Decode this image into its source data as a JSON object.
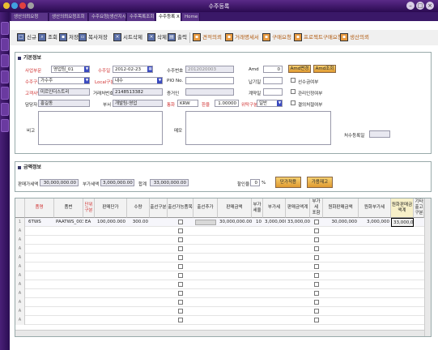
{
  "window": {
    "title": "수주등록"
  },
  "tabs": [
    {
      "label": "생산의뢰요청"
    },
    {
      "label": "생산의뢰요청조회"
    },
    {
      "label": "수주요청[생산지시]"
    },
    {
      "label": "수주목록조회"
    },
    {
      "label": "수주등록 X"
    },
    {
      "label": "Home"
    }
  ],
  "toolbar": {
    "new": "신규",
    "search": "조회",
    "save": "저장",
    "copy": "복사저장",
    "delete_sheet": "시트삭제",
    "delete": "삭제",
    "print": "출력",
    "quote": "견적의뢰",
    "trade": "거래명세서",
    "purchase": "구매요청",
    "project": "프로젝트구매요청",
    "production": "생산의뢰"
  },
  "basic": {
    "header": "기본정보",
    "labels": {
      "dept": "사업부문",
      "order_date": "수주일",
      "order_no": "수주번호",
      "amd": "Amd",
      "order_type": "수주구분",
      "local": "Local구분",
      "pio": "PIO No.",
      "due": "납기일",
      "pre_order": "선수금여부",
      "customer": "고객사명",
      "biz_no": "거래처번호",
      "cert": "증거인",
      "contract": "계약일",
      "mgmt": "관리인정여부",
      "manager": "담당자",
      "mcode": "부서",
      "currency": "통화",
      "rate": "환율",
      "tax": "위탁구분",
      "tax_check": "결의처절여부",
      "remark": "비고",
      "memo": "메모",
      "registrar": "처수등록일"
    },
    "values": {
      "dept": "영업팀_01",
      "order_date": "2012-02-23",
      "order_no": "2012020003",
      "amd": "0",
      "order_type": "가수주",
      "local": "내수",
      "customer": "미르인더스트리",
      "biz_no": "2148513382",
      "manager": "홍길동",
      "mcode": "개발팀-영업",
      "currency": "KRW",
      "rate": "1.00000",
      "tax": "일반"
    },
    "buttons": {
      "amd_change": "Amd변경",
      "amd_view": "Amd조회"
    }
  },
  "amount": {
    "header": "금액정보",
    "labels": {
      "supply": "판매가세액",
      "vat": "부가세액",
      "total": "합계",
      "discount": "할인율",
      "pct": "%"
    },
    "values": {
      "supply": "30,000,000.00",
      "vat": "3,000,000.00",
      "total": "33,000,000.00",
      "discount": "0"
    },
    "buttons": {
      "price_apply": "단가적용",
      "stock": "가용재고"
    }
  },
  "grid": {
    "columns": [
      "품명",
      "품번",
      "단위\n구분",
      "판매단가",
      "수량",
      "출선구분",
      "출선가능품목",
      "출선추가",
      "판매금액",
      "부가\n세율",
      "부가세",
      "판매금액계",
      "부가세\n포함",
      "원화판매금액",
      "원화부가세",
      "원화판매금\n액계",
      "기타출고구분"
    ],
    "rows": [
      {
        "name": "6TWS",
        "code": "PAATWS_003",
        "unit": "EA",
        "price": "100,000.000",
        "qty": "300.00",
        "amount": "30,000,000.00",
        "taxrate": "10",
        "vat": "3,000,000.00",
        "total": "33,000,000.00",
        "won": "30,000,000",
        "wonvat": "3,000,000",
        "wontotal": "33,000,000"
      }
    ]
  }
}
